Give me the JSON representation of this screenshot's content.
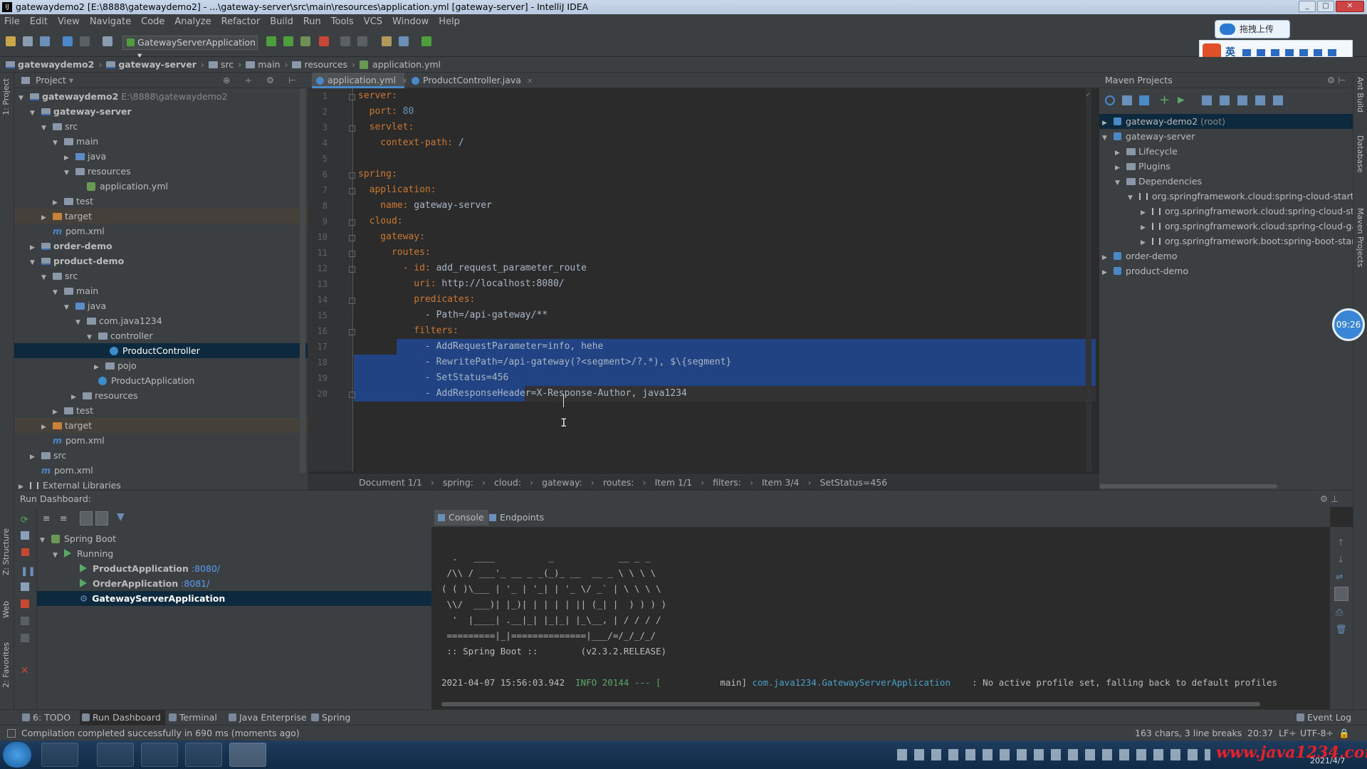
{
  "window": {
    "title": "gatewaydemo2 [E:\\8888\\gatewaydemo2] - ...\\gateway-server\\src\\main\\resources\\application.yml [gateway-server] - IntelliJ IDEA"
  },
  "menu": [
    "File",
    "Edit",
    "View",
    "Navigate",
    "Code",
    "Analyze",
    "Refactor",
    "Build",
    "Run",
    "Tools",
    "VCS",
    "Window",
    "Help"
  ],
  "toolbar": {
    "run_config": "GatewayServerApplication"
  },
  "breadcrumb": [
    "gatewaydemo2",
    "gateway-server",
    "src",
    "main",
    "resources",
    "application.yml"
  ],
  "project": {
    "header": "Project",
    "tree": [
      {
        "label": "gatewaydemo2",
        "suffix": "E:\\8888\\gatewaydemo2"
      },
      {
        "label": "gateway-server"
      },
      {
        "label": "src"
      },
      {
        "label": "main"
      },
      {
        "label": "java"
      },
      {
        "label": "resources"
      },
      {
        "label": "application.yml"
      },
      {
        "label": "test"
      },
      {
        "label": "target"
      },
      {
        "label": "pom.xml"
      },
      {
        "label": "order-demo"
      },
      {
        "label": "product-demo"
      },
      {
        "label": "src"
      },
      {
        "label": "main"
      },
      {
        "label": "java"
      },
      {
        "label": "com.java1234"
      },
      {
        "label": "controller"
      },
      {
        "label": "ProductController"
      },
      {
        "label": "pojo"
      },
      {
        "label": "ProductApplication"
      },
      {
        "label": "resources"
      },
      {
        "label": "test"
      },
      {
        "label": "target"
      },
      {
        "label": "pom.xml"
      },
      {
        "label": "src"
      },
      {
        "label": "pom.xml"
      },
      {
        "label": "External Libraries"
      }
    ]
  },
  "editor": {
    "tabs": [
      "application.yml",
      "ProductController.java"
    ],
    "line_numbers": [
      "1",
      "2",
      "3",
      "4",
      "5",
      "6",
      "7",
      "8",
      "9",
      "10",
      "11",
      "12",
      "13",
      "14",
      "15",
      "16",
      "17",
      "18",
      "19",
      "20"
    ],
    "lines": [
      {
        "key": "server:",
        "val": ""
      },
      {
        "key": "  port:",
        "val": " 80"
      },
      {
        "key": "  servlet:",
        "val": ""
      },
      {
        "key": "    context-path:",
        "val": " /"
      },
      {
        "key": "",
        "val": ""
      },
      {
        "key": "spring:",
        "val": ""
      },
      {
        "key": "  application:",
        "val": ""
      },
      {
        "key": "    name:",
        "val": " gateway-server"
      },
      {
        "key": "  cloud:",
        "val": ""
      },
      {
        "key": "    gateway:",
        "val": ""
      },
      {
        "key": "      routes:",
        "val": ""
      },
      {
        "key": "        - id:",
        "val": " add_request_parameter_route"
      },
      {
        "key": "          uri:",
        "val": " http://localhost:8080/"
      },
      {
        "key": "          predicates:",
        "val": ""
      },
      {
        "key": "",
        "val": "            - Path=/api-gateway/**"
      },
      {
        "key": "          filters:",
        "val": ""
      },
      {
        "key": "",
        "val": "            - AddRequestParameter=info, hehe"
      },
      {
        "key": "",
        "val": "            - RewritePath=/api-gateway(?<segment>/?.*), $\\{segment}"
      },
      {
        "key": "",
        "val": "            - SetStatus=456"
      },
      {
        "key": "",
        "val": "            - AddResponseHeader=X-Response-Author, java1234"
      }
    ],
    "status": [
      "Document 1/1",
      "spring:",
      "cloud:",
      "gateway:",
      "routes:",
      "Item 1/1",
      "filters:",
      "Item 3/4",
      "SetStatus=456"
    ]
  },
  "maven": {
    "header": "Maven Projects",
    "tree": [
      {
        "label": "gateway-demo2",
        "suffix": "(root)"
      },
      {
        "label": "gateway-server"
      },
      {
        "label": "Lifecycle"
      },
      {
        "label": "Plugins"
      },
      {
        "label": "Dependencies"
      },
      {
        "label": "org.springframework.cloud:spring-cloud-starter"
      },
      {
        "label": "org.springframework.cloud:spring-cloud-star"
      },
      {
        "label": "org.springframework.cloud:spring-cloud-gat"
      },
      {
        "label": "org.springframework.boot:spring-boot-start"
      },
      {
        "label": "order-demo"
      },
      {
        "label": "product-demo"
      }
    ]
  },
  "clock": "09:26",
  "run_dashboard": {
    "header": "Run Dashboard:",
    "tree": [
      {
        "label": "Spring Boot"
      },
      {
        "label": "Running"
      },
      {
        "label": "ProductApplication",
        "port": ":8080/"
      },
      {
        "label": "OrderApplication",
        "port": ":8081/"
      },
      {
        "label": "GatewayServerApplication"
      }
    ]
  },
  "console": {
    "tabs": [
      "Console",
      "Endpoints"
    ],
    "lines": [
      "  .   ____          _            __ _ _",
      " /\\\\ / ___'_ __ _ _(_)_ __  __ _ \\ \\ \\ \\",
      "( ( )\\___ | '_ | '_| | '_ \\/ _` | \\ \\ \\ \\",
      " \\\\/  ___)| |_)| | | | | || (_| |  ) ) ) )",
      "  '  |____| .__|_| |_|_| |_\\__, | / / / /",
      " =========|_|==============|___/=/_/_/_/",
      " :: Spring Boot ::        (v2.3.2.RELEASE)"
    ],
    "log_time": "2021-04-07 15:56:03.942",
    "log_level": "INFO 20144 --- [",
    "log_thread": "           main]",
    "log_class": "com.java1234.GatewayServerApplication",
    "log_msg": ": No active profile set, falling back to default profiles"
  },
  "bottom_tabs": [
    "6: TODO",
    "Run Dashboard",
    "Terminal",
    "Java Enterprise",
    "Spring"
  ],
  "event_log": "Event Log",
  "status": {
    "message": "Compilation completed successfully in 690 ms (moments ago)",
    "chars": "163 chars, 3 line breaks",
    "position": "20:37",
    "line_sep": "LF÷",
    "encoding": "UTF-8÷"
  },
  "side_tabs": {
    "left": [
      "1: Project",
      "Z: Structure",
      "Web",
      "2: Favorites"
    ],
    "right": [
      "Ant Build",
      "Database",
      "Maven Projects"
    ]
  },
  "upload_button": "拖拽上传",
  "watermark": "www.java1234.com",
  "tray_date": "2021/4/7",
  "ime": {
    "label": "英"
  }
}
